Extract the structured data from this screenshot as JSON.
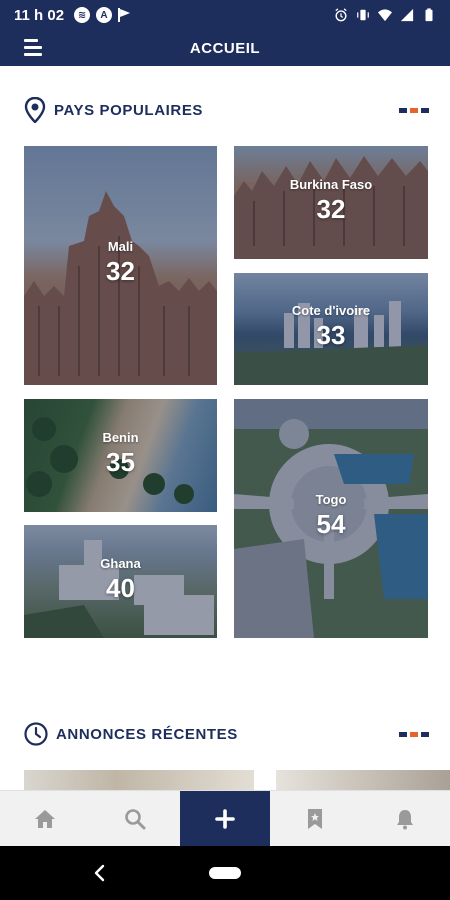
{
  "status_bar": {
    "time": "11 h 02",
    "left_icons": [
      "spotify-icon",
      "a-badge-icon",
      "flag-icon"
    ],
    "right_icons": [
      "alarm-icon",
      "vibrate-icon",
      "wifi-icon",
      "signal-icon",
      "battery-icon"
    ]
  },
  "app_bar": {
    "title": "ACCUEIL",
    "menu_icon": "hamburger-menu-icon"
  },
  "popular": {
    "title": "PAYS POPULAIRES",
    "icon": "location-pin-icon",
    "countries": [
      {
        "name": "Mali",
        "count": "32"
      },
      {
        "name": "Burkina Faso",
        "count": "32"
      },
      {
        "name": "Cote d'ivoire",
        "count": "33"
      },
      {
        "name": "Benin",
        "count": "35"
      },
      {
        "name": "Togo",
        "count": "54"
      },
      {
        "name": "Ghana",
        "count": "40"
      }
    ]
  },
  "recent": {
    "title": "ANNONCES RÉCENTES",
    "icon": "clock-icon"
  },
  "bottom_nav": {
    "items": [
      "home-icon",
      "search-icon",
      "plus-icon",
      "bookmark-icon",
      "bell-icon"
    ],
    "active_index": 2
  },
  "colors": {
    "primary": "#1d2d5c",
    "accent": "#e8632b",
    "nav_background": "#f1f1f1"
  }
}
